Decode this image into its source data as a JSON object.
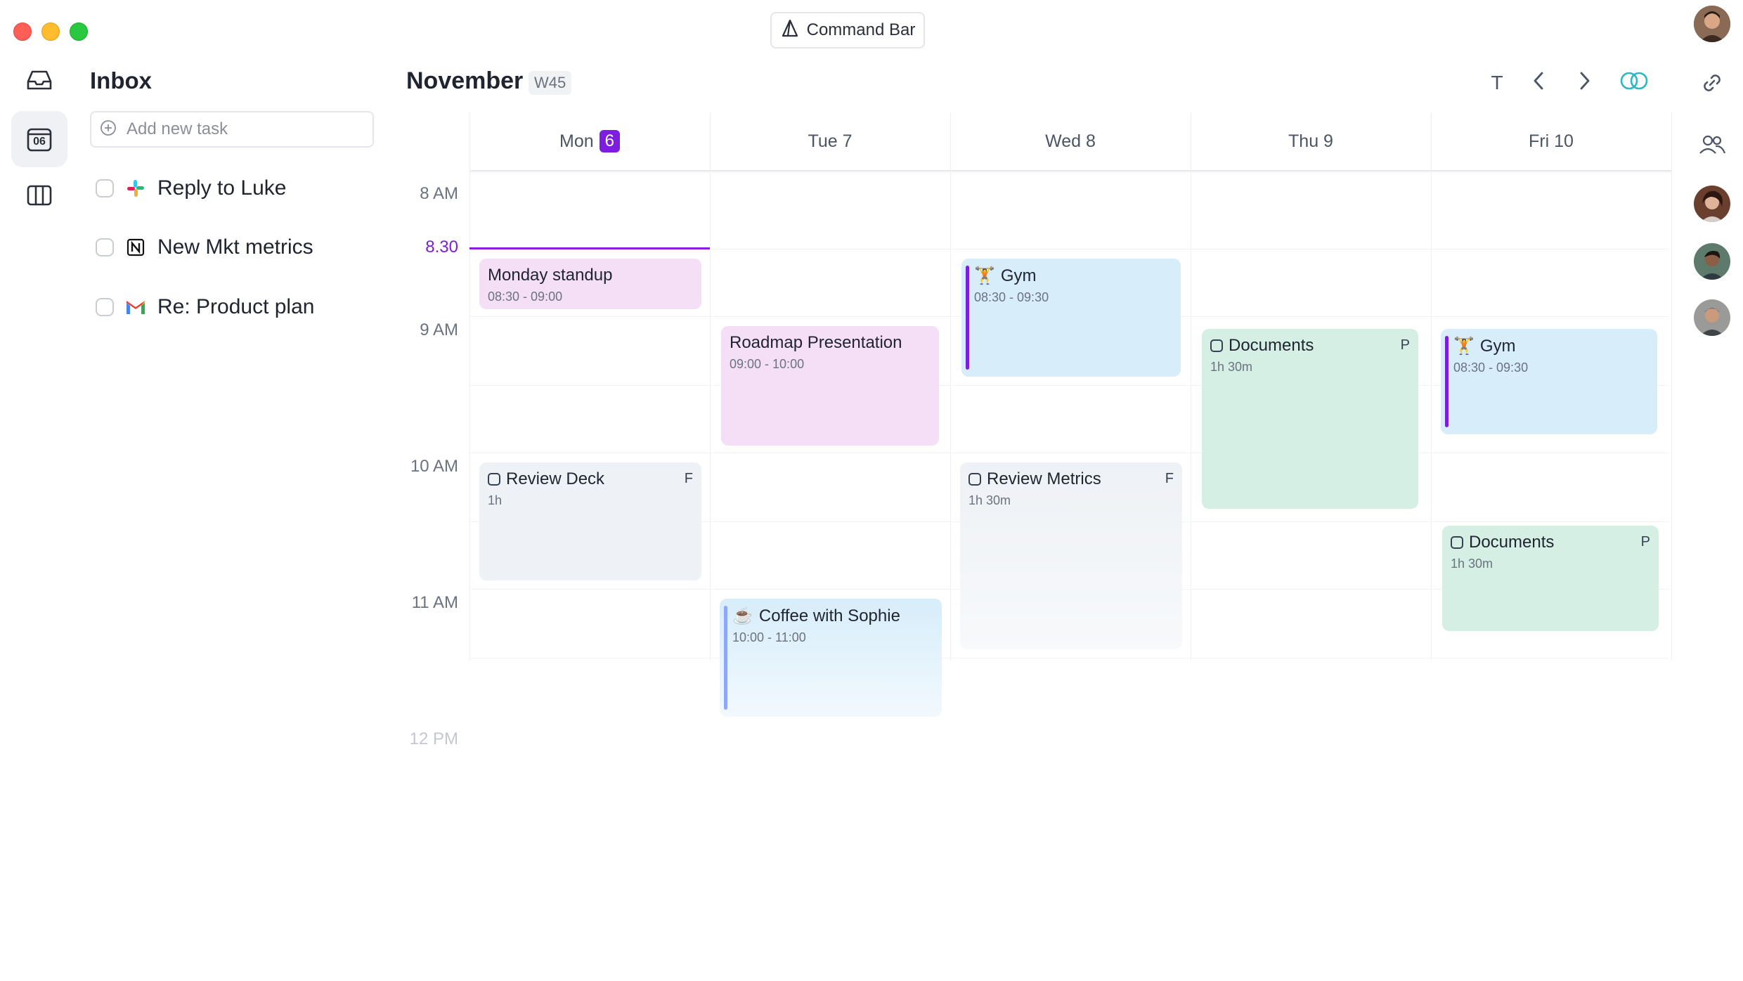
{
  "window": {
    "command_bar_label": "Command Bar"
  },
  "nav": {
    "calendar_date": "06"
  },
  "inbox": {
    "title": "Inbox",
    "add_task_placeholder": "Add new task",
    "tasks": [
      {
        "label": "Reply to Luke",
        "app": "slack-icon"
      },
      {
        "label": "New Mkt metrics",
        "app": "notion-icon"
      },
      {
        "label": "Re: Product plan",
        "app": "gmail-icon"
      }
    ]
  },
  "calendar": {
    "month": "November",
    "week": "W45",
    "today_button": "T",
    "days": [
      {
        "label": "Mon",
        "badge": "6"
      },
      {
        "label": "Tue 7"
      },
      {
        "label": "Wed 8"
      },
      {
        "label": "Thu 9"
      },
      {
        "label": "Fri 10"
      }
    ],
    "times": [
      "8 AM",
      "8.30",
      "9 AM",
      "10 AM",
      "11 AM",
      "12 PM"
    ],
    "events": {
      "mon_standup": {
        "title": "Monday standup",
        "time": "08:30 - 09:00"
      },
      "mon_review": {
        "title": "Review Deck",
        "time": "1h",
        "tag": "F"
      },
      "tue_roadmap": {
        "title": "Roadmap Presentation",
        "time": "09:00 - 10:00"
      },
      "tue_coffee": {
        "title": "Coffee with Sophie",
        "time": "10:00 - 11:00",
        "emoji": "☕"
      },
      "wed_gym": {
        "title": "Gym",
        "time": "08:30 - 09:30",
        "emoji": "🏋"
      },
      "wed_review": {
        "title": "Review Metrics",
        "time": "1h 30m",
        "tag": "F"
      },
      "thu_docs": {
        "title": "Documents",
        "time": "1h 30m",
        "tag": "P"
      },
      "fri_gym": {
        "title": "Gym",
        "time": "08:30 - 09:30",
        "emoji": "🏋"
      },
      "fri_docs": {
        "title": "Documents",
        "time": "1h 30m",
        "tag": "P"
      }
    }
  },
  "colors": {
    "accent": "#7c1ddf",
    "pink_event": "#f5dff7",
    "blue_event": "#d7edfa",
    "green_event": "#d6efe4",
    "gray_event": "#eef1f5"
  }
}
